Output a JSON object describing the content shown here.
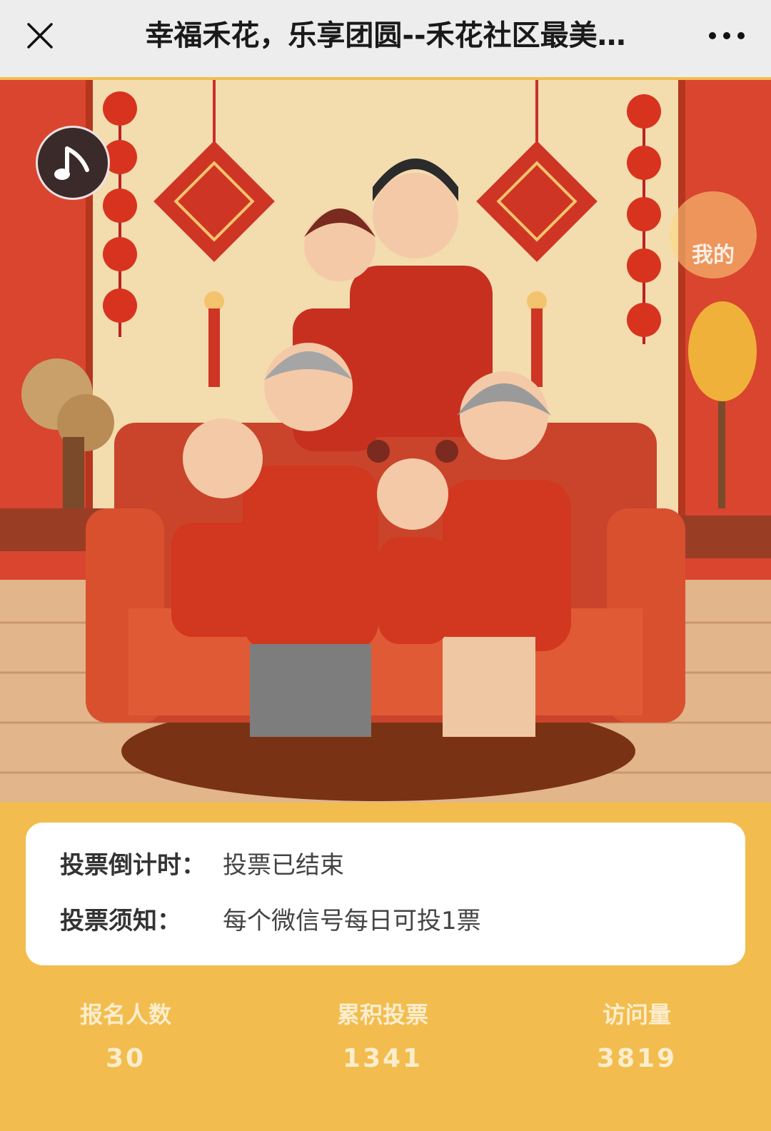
{
  "header": {
    "close_icon": "close-icon",
    "title": "幸福禾花，乐享团圆--禾花社区最美…",
    "more_icon": "more-icon"
  },
  "banner": {
    "music_icon": "music-note-icon",
    "mine_label": "我的",
    "colors": {
      "wall": "#f6e7c6",
      "sofa": "#d64e2c",
      "floor": "#e7b98a",
      "red": "#c8302a"
    }
  },
  "info": {
    "countdown_label": "投票倒计时：",
    "countdown_value": "投票已结束",
    "notice_label": "投票须知：",
    "notice_value": "每个微信号每日可投1票"
  },
  "stats": [
    {
      "label": "报名人数",
      "value": "30"
    },
    {
      "label": "累积投票",
      "value": "1341"
    },
    {
      "label": "访问量",
      "value": "3819"
    }
  ]
}
